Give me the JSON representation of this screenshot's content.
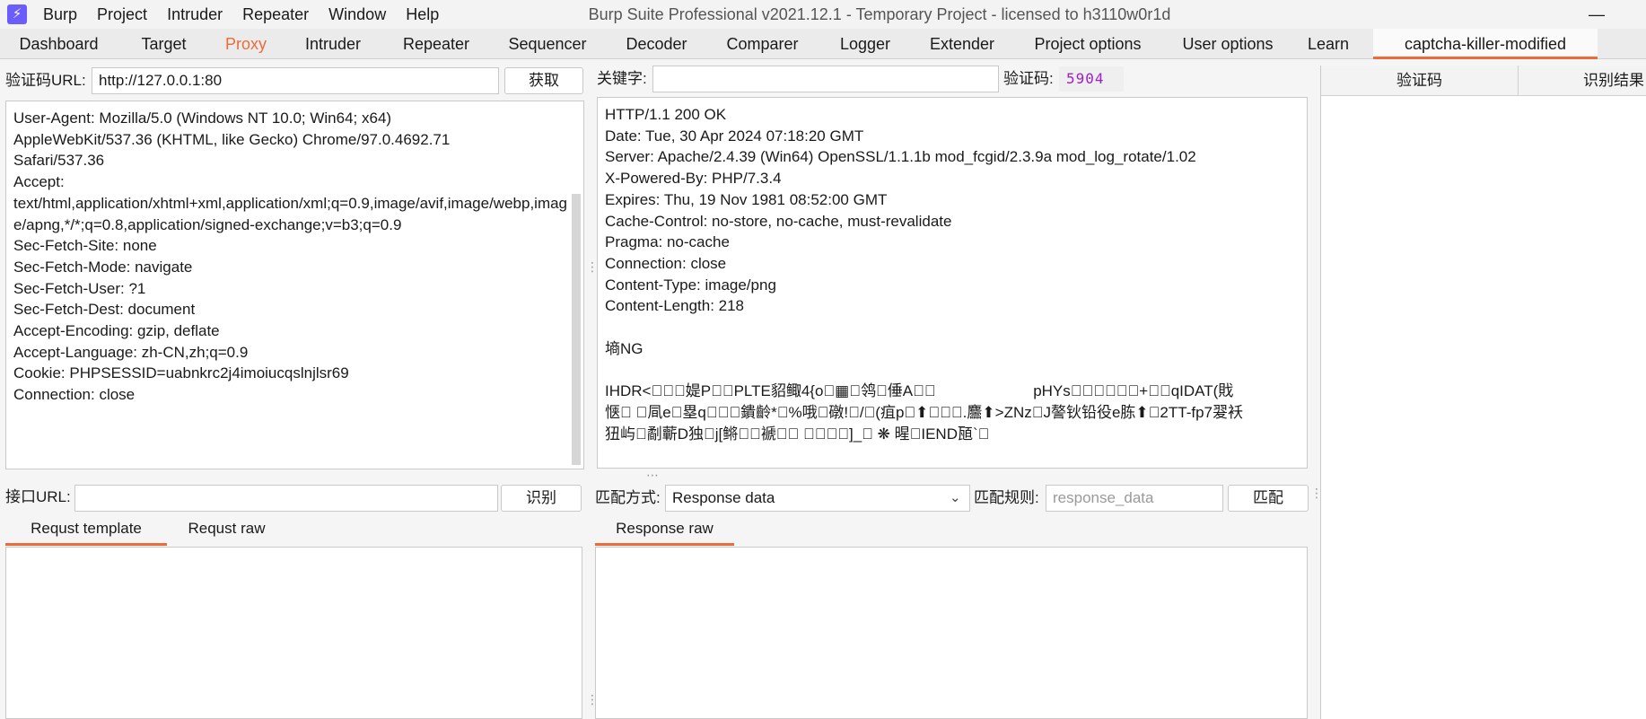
{
  "titlebar": {
    "title": "Burp Suite Professional v2021.12.1 - Temporary Project - licensed to h3110w0r1d",
    "app_icon_glyph": "⚡",
    "minimize_glyph": "—",
    "menu": [
      "Burp",
      "Project",
      "Intruder",
      "Repeater",
      "Window",
      "Help"
    ]
  },
  "tabs": [
    "Dashboard",
    "Target",
    "Proxy",
    "Intruder",
    "Repeater",
    "Sequencer",
    "Decoder",
    "Comparer",
    "Logger",
    "Extender",
    "Project options",
    "User options",
    "Learn",
    "captcha-killer-modified"
  ],
  "accent_color": "#ec6b3b",
  "captcha_panel": {
    "url_label": "验证码URL:",
    "url_value": "http://127.0.0.1:80",
    "fetch_button": "获取",
    "request_text": "User-Agent: Mozilla/5.0 (Windows NT 10.0; Win64; x64)\nAppleWebKit/537.36 (KHTML, like Gecko) Chrome/97.0.4692.71\nSafari/537.36\nAccept:\ntext/html,application/xhtml+xml,application/xml;q=0.9,image/avif,image/webp,image/apng,*/*;q=0.8,application/signed-exchange;v=b3;q=0.9\nSec-Fetch-Site: none\nSec-Fetch-Mode: navigate\nSec-Fetch-User: ?1\nSec-Fetch-Dest: document\nAccept-Encoding: gzip, deflate\nAccept-Language: zh-CN,zh;q=0.9\nCookie: PHPSESSID=uabnkrc2j4imoiucqslnjlsr69\nConnection: close"
  },
  "response_panel": {
    "keyword_label": "关键字:",
    "keyword_value": "",
    "captcha_label": "验证码:",
    "captcha_value": "5904",
    "response_text": "HTTP/1.1 200 OK\nDate: Tue, 30 Apr 2024 07:18:20 GMT\nServer: Apache/2.4.39 (Win64) OpenSSL/1.1.1b mod_fcgid/2.3.9a mod_log_rotate/1.02\nX-Powered-By: PHP/7.3.4\nExpires: Thu, 19 Nov 1981 08:52:00 GMT\nCache-Control: no-store, no-cache, must-revalidate\nPragma: no-cache\nConnection: close\nContent-Type: image/png\nContent-Length: 218\n\n墒NG\n\nIHDR<\u0000\u0000\u0000媞P\u0000\u0000PLTE貂鲰4{o\u0000▦\u0000鸰\u0000倕A\u0000\u0000                       pHYs\u0000\u0000\u0000\u0000\u0000\u0000+\u0000\u0000qIDAT(戝\n惬\u0000 \u0000凬e\u0000塁q\u0000\u0000\u0000鐀齡*\u0000%哦\u0000礅!\u0000/\u0000(疽p\u0000⬆\u0000\u0000\u0000.麢⬆>ZNz\u0000J謷钬铅役e胨⬆\u00002TT-fp7翇袄\n狃屿\u0000劀蘄D独\u0000j[鳉\u0000\u0000褫\u0000\u0000 \u0000\u0000\u0000\u0000]_\u0000 ❋ 暒\u0000IEND瓸`\u0000"
  },
  "result_table": {
    "columns": [
      "验证码",
      "识别结果"
    ]
  },
  "api_panel": {
    "url_label": "接口URL:",
    "url_value": "",
    "recognize_button": "识别",
    "tabs": [
      "Requst template",
      "Requst raw"
    ]
  },
  "match_panel": {
    "mode_label": "匹配方式:",
    "mode_value": "Response data",
    "rule_label": "匹配规则:",
    "rule_placeholder": "response_data",
    "match_button": "匹配",
    "tabs": [
      "Response raw"
    ]
  }
}
